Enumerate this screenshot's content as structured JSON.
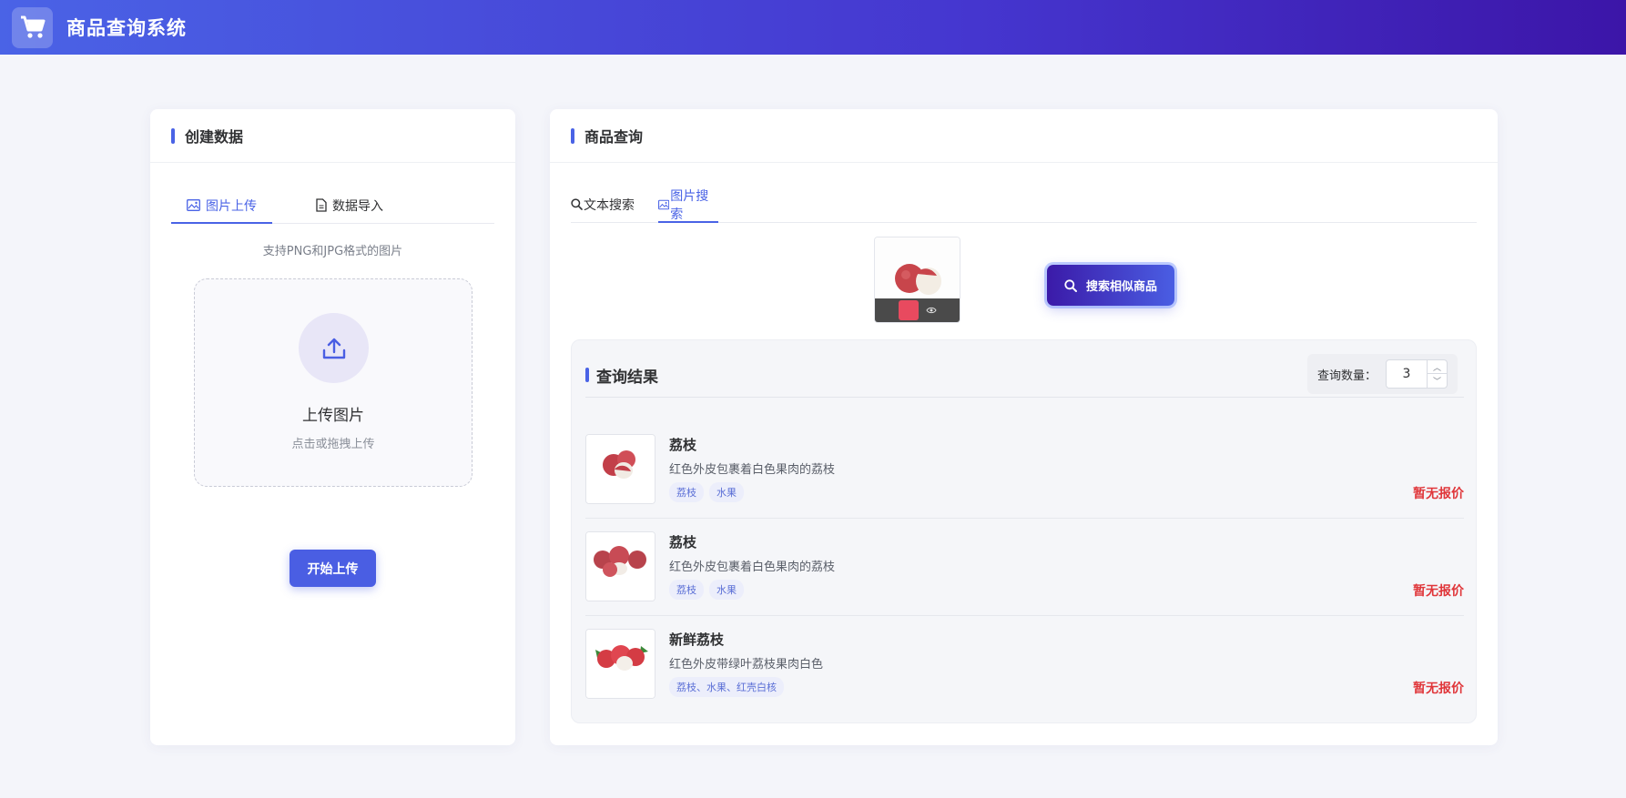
{
  "header": {
    "title": "商品查询系统",
    "logo_icon": "cart-icon"
  },
  "left_card": {
    "title": "创建数据",
    "tabs": [
      {
        "label": "图片上传",
        "icon": "image-icon",
        "active": true
      },
      {
        "label": "数据导入",
        "icon": "file-icon",
        "active": false
      }
    ],
    "hint": "支持PNG和JPG格式的图片",
    "dropzone": {
      "title": "上传图片",
      "subtitle": "点击或拖拽上传",
      "icon": "upload-icon"
    },
    "upload_button": "开始上传"
  },
  "right_card": {
    "title": "商品查询",
    "tabs": [
      {
        "label": "文本搜索",
        "icon": "search-icon",
        "active": false
      },
      {
        "label": "图片搜索",
        "icon": "image-icon",
        "active": true
      }
    ],
    "search_button": "搜索相似商品",
    "results": {
      "title": "查询结果",
      "quantity_label": "查询数量：",
      "quantity_value": "3",
      "items": [
        {
          "name": "荔枝",
          "desc": "红色外皮包裹着白色果肉的荔枝",
          "tags": [
            "荔枝",
            "水果"
          ],
          "price": "暂无报价"
        },
        {
          "name": "荔枝",
          "desc": "红色外皮包裹着白色果肉的荔枝",
          "tags": [
            "荔枝",
            "水果"
          ],
          "price": "暂无报价"
        },
        {
          "name": "新鲜荔枝",
          "desc": "红色外皮带绿叶荔枝果肉白色",
          "tags": [
            "荔枝、水果、红壳白核"
          ],
          "price": "暂无报价"
        }
      ]
    }
  },
  "colors": {
    "accent": "#4a63e6",
    "price": "#e0363a",
    "header_end": "#3c15a8"
  }
}
